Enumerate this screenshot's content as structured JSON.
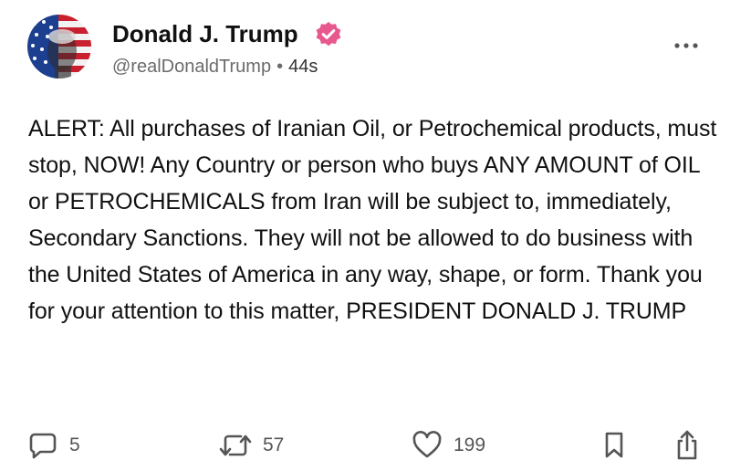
{
  "author": {
    "name": "Donald J. Trump",
    "handle": "@realDonaldTrump",
    "separator": "•",
    "time": "44s",
    "verified_color": "#e7588f"
  },
  "post": {
    "text": "ALERT: All purchases of Iranian Oil, or Petrochemical products, must stop, NOW! Any Country or person who buys ANY AMOUNT of OIL or PETROCHEMICALS from Iran will be subject to, immediately, Secondary Sanctions. They will not be allowed to do business with the United States of America in any way, shape, or form. Thank you for your attention to this matter, PRESIDENT DONALD J. TRUMP"
  },
  "actions": {
    "reply": {
      "icon": "reply-icon",
      "count": "5"
    },
    "retruth": {
      "icon": "retruth-icon",
      "count": "57"
    },
    "like": {
      "icon": "heart-icon",
      "count": "199"
    },
    "bookmark": {
      "icon": "bookmark-icon"
    },
    "share": {
      "icon": "share-icon"
    }
  },
  "menu": {
    "icon": "more-options-icon"
  }
}
